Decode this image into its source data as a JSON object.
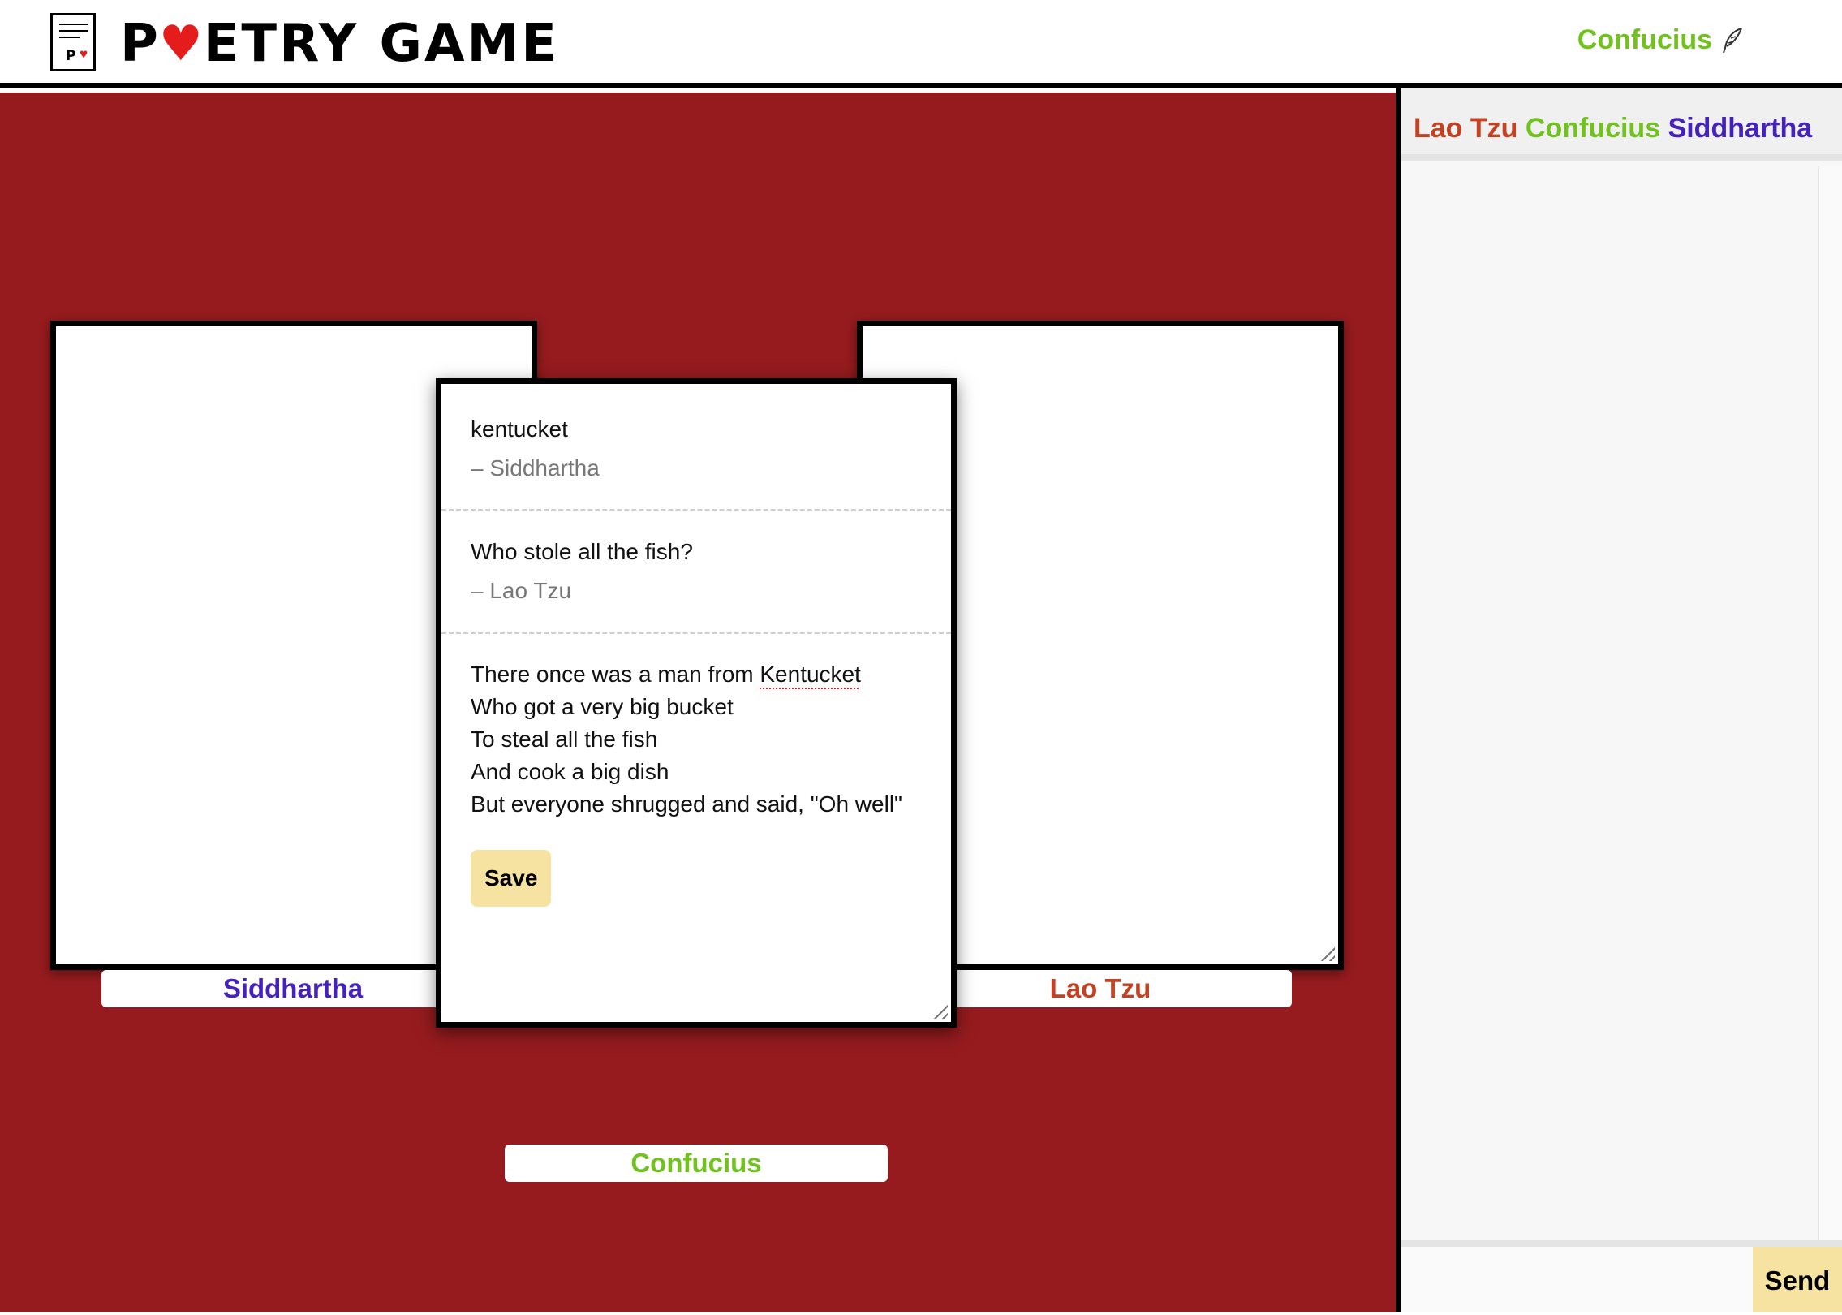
{
  "header": {
    "title_prefix": "P",
    "title_suffix": "ETRY GAME",
    "title_heart": "♥",
    "logo_letter": "P",
    "logo_heart": "♥",
    "current_user": "Confucius",
    "icons": {
      "logo": "poem-document-icon",
      "quill": "quill-icon"
    }
  },
  "players": {
    "left": "Siddhartha",
    "right": "Lao Tzu",
    "bottom": "Confucius"
  },
  "active_card": {
    "entries": [
      {
        "text": "kentucket",
        "author": "– Siddhartha"
      },
      {
        "text": "Who stole all the fish?",
        "author": "– Lao Tzu"
      }
    ],
    "poem_lines": [
      {
        "before": "There once was a man from ",
        "misspelled": "Kentucket"
      },
      {
        "before": "Who got a very big bucket",
        "misspelled": ""
      },
      {
        "before": "To steal all the fish",
        "misspelled": ""
      },
      {
        "before": "And cook a big dish",
        "misspelled": ""
      },
      {
        "before": "But everyone shrugged and said, \"Oh well\"",
        "misspelled": ""
      }
    ],
    "save_label": "Save"
  },
  "chat": {
    "participants": [
      "Lao Tzu",
      "Confucius",
      "Siddhartha"
    ],
    "send_label": "Send"
  },
  "colors": {
    "game_bg": "#951b1e",
    "siddhartha": "#4422bb",
    "lao_tzu": "#c24222",
    "confucius": "#71c21f",
    "button": "#f7e3a1"
  }
}
